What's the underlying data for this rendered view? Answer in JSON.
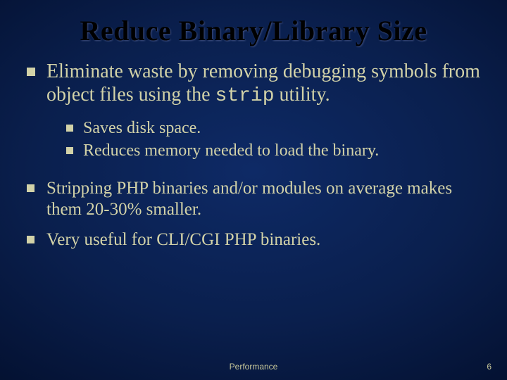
{
  "title": "Reduce Binary/Library Size",
  "bullets": {
    "b1_pre": "Eliminate waste by removing debugging symbols from object files using the ",
    "b1_code": "strip",
    "b1_post": " utility.",
    "b1_sub1": "Saves disk space.",
    "b1_sub2": "Reduces memory needed to load the binary.",
    "b2": "Stripping PHP binaries and/or modules on average makes them 20-30% smaller.",
    "b3": "Very useful for CLI/CGI PHP binaries."
  },
  "footer": {
    "center": "Performance",
    "page": "6"
  }
}
